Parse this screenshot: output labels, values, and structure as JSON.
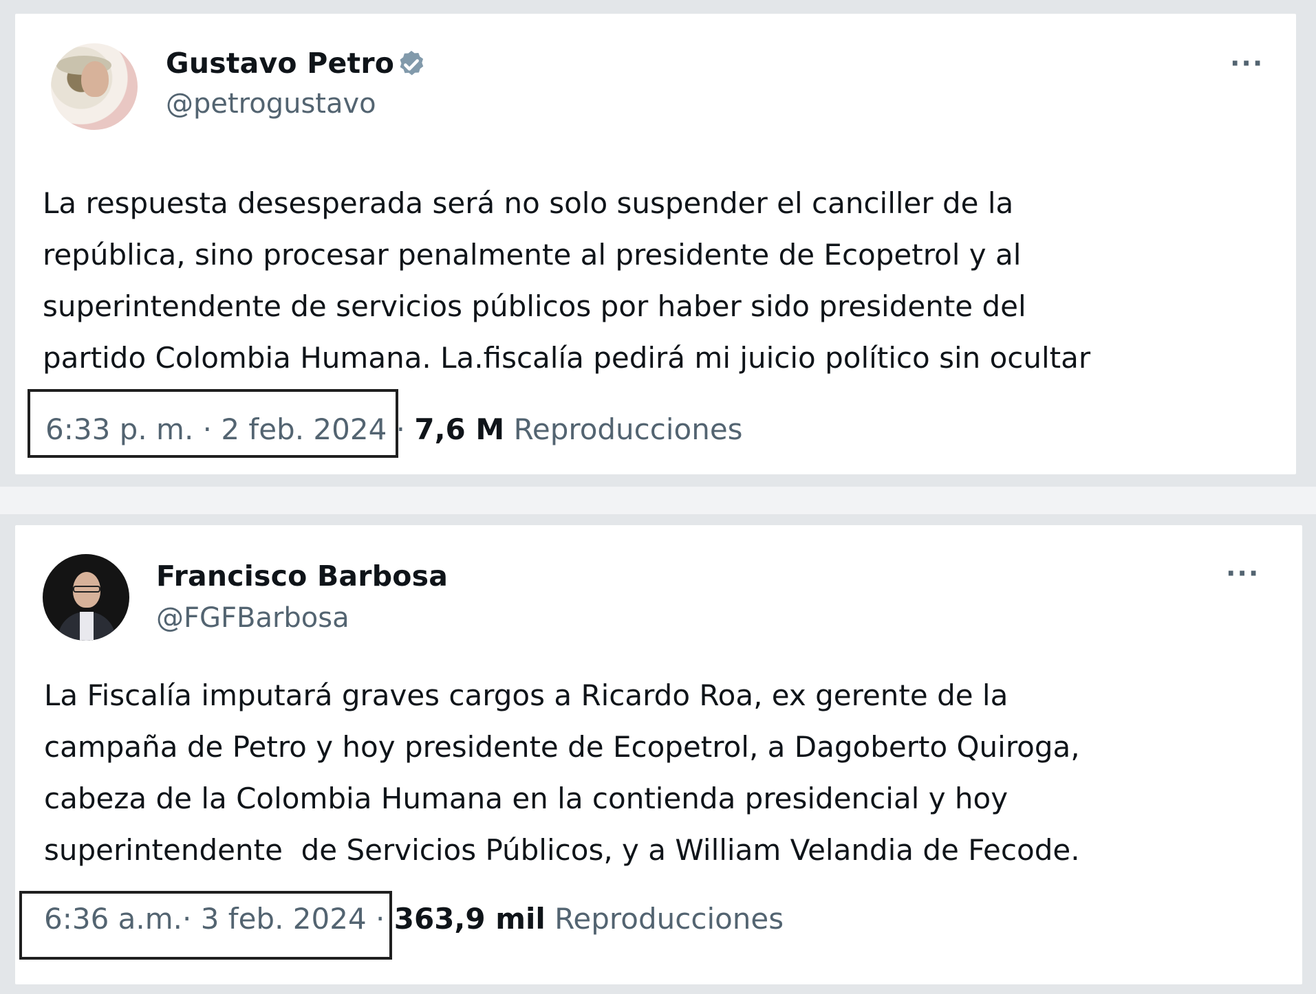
{
  "tweets": [
    {
      "author_name": "Gustavo Petro",
      "handle": "@petrogustavo",
      "verified": true,
      "more_icon": "···",
      "text": "La respuesta desesperada será no solo suspender el canciller de la\nrepública, sino procesar penalmente al presidente de Ecopetrol y al\nsuperintendente de servicios públicos por haber sido presidente del\npartido Colombia Humana. La.fiscalía pedirá mi juicio político sin ocultar",
      "time": "6:33 p. m. · 2 feb. 2024",
      "separator": "·",
      "views_count": "7,6 M",
      "views_label": "Reproducciones"
    },
    {
      "author_name": "Francisco Barbosa",
      "handle": "@FGFBarbosa",
      "verified": false,
      "more_icon": "···",
      "text": "La Fiscalía imputará graves cargos a Ricardo Roa, ex gerente de la\ncampaña de Petro y hoy presidente de Ecopetrol, a Dagoberto Quiroga,\ncabeza de la Colombia Humana en la contienda presidencial y hoy\nsuperintendente  de Servicios Públicos, y a William Velandia de Fecode.",
      "time": "6:36 a.m.· 3 feb. 2024",
      "separator": "·",
      "views_count": "363,9 mil",
      "views_label": "Reproducciones"
    }
  ],
  "colors": {
    "verified_badge": "#829aab",
    "text_primary": "#0f1419",
    "text_secondary": "#536471",
    "page_background": "#e3e6e9",
    "highlight_border": "#1f1f1f"
  }
}
